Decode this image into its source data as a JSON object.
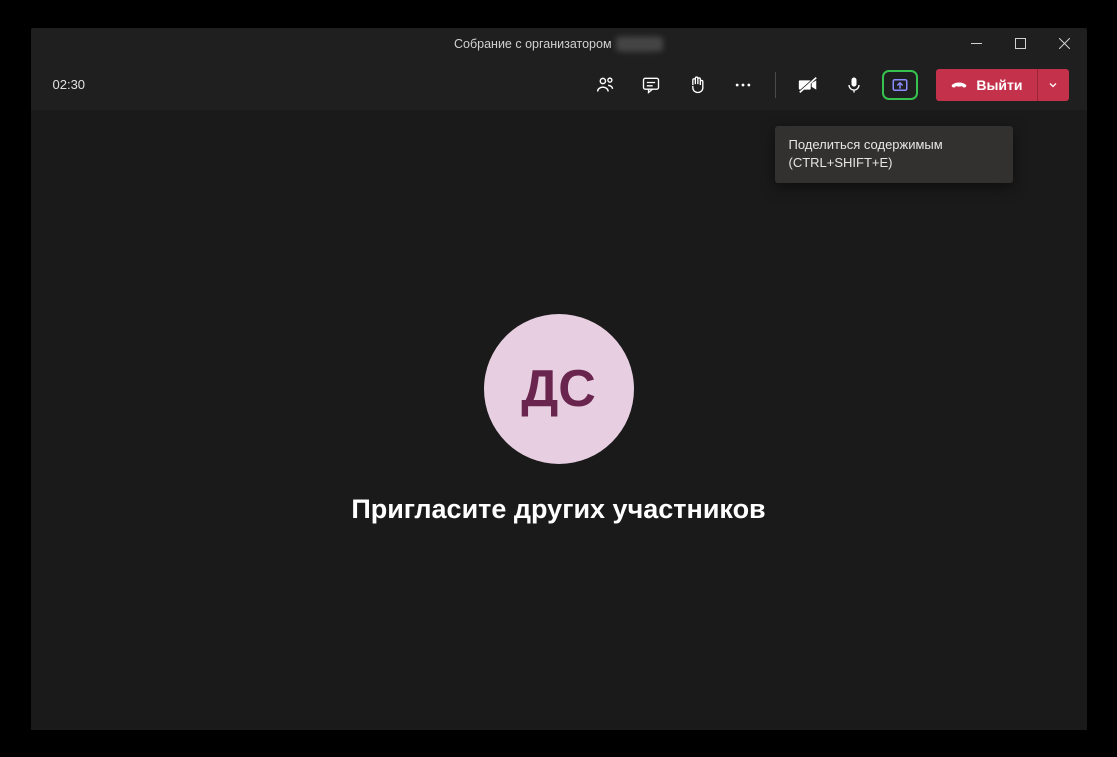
{
  "title": {
    "prefix": "Собрание с организатором",
    "organizer_hidden": "████"
  },
  "toolbar": {
    "timer": "02:30",
    "leave_label": "Выйти"
  },
  "tooltip": {
    "line1": "Поделиться содержимым",
    "line2": "(CTRL+SHIFT+E)"
  },
  "content": {
    "avatar_initials": "ДС",
    "invite_text": "Пригласите других участников"
  },
  "colors": {
    "leave_bg": "#c4314b",
    "share_highlight": "#36c24e",
    "avatar_bg": "#e7cfe1",
    "avatar_fg": "#69254e"
  }
}
